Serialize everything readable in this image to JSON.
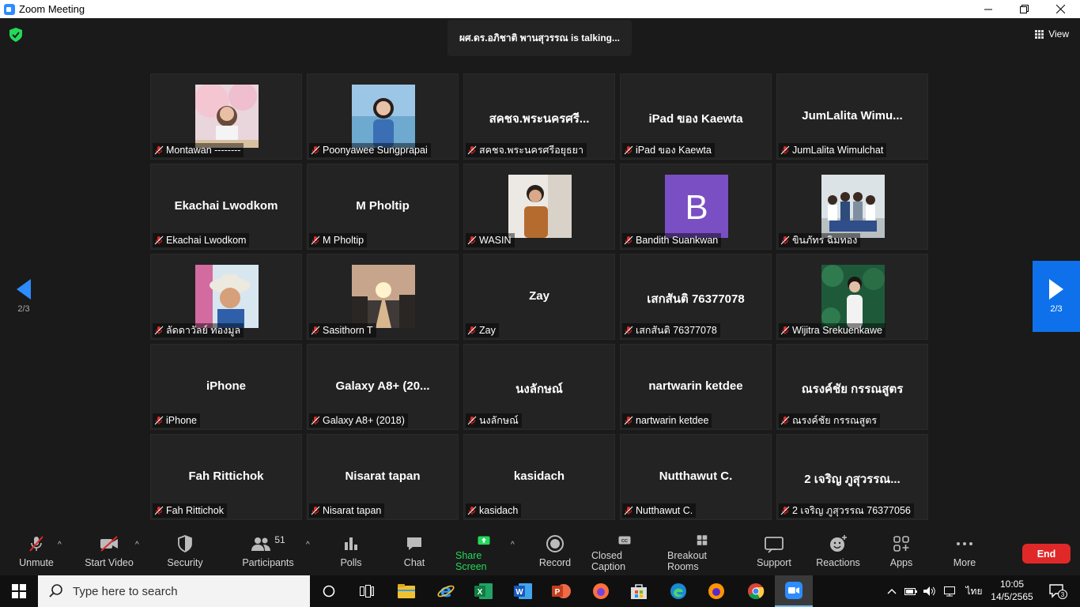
{
  "window": {
    "title": "Zoom Meeting"
  },
  "meeting": {
    "talking_text": "ผศ.ดร.อภิชาติ พานสุวรรณ  is  talking...",
    "view_label": "View",
    "page_indicator_left": "2/3",
    "page_indicator_right": "2/3"
  },
  "participants": [
    {
      "display": "",
      "label": "Montawan --------",
      "photo": "blossom"
    },
    {
      "display": "",
      "label": "Poonyawee Sungprapai",
      "photo": "beach"
    },
    {
      "display": "สคชจ.พระนครศรี...",
      "label": "สคชจ.พระนครศรีอยุธยา",
      "photo": ""
    },
    {
      "display": "iPad ของ Kaewta",
      "label": "iPad ของ Kaewta",
      "photo": ""
    },
    {
      "display": "JumLalita  Wimu...",
      "label": "JumLalita Wimulchat",
      "photo": ""
    },
    {
      "display": "Ekachai Lwodkom",
      "label": "Ekachai Lwodkom",
      "photo": ""
    },
    {
      "display": "M Pholtip",
      "label": "M Pholtip",
      "photo": ""
    },
    {
      "display": "",
      "label": "WASIN",
      "photo": "selfie"
    },
    {
      "display": "",
      "label": "Bandith Suankwan",
      "photo": "avatar-b",
      "avatar_letter": "B"
    },
    {
      "display": "",
      "label": "ขินภัทร ฉิมทอง",
      "photo": "group"
    },
    {
      "display": "",
      "label": "ลัดดาวัลย์ ทองมูล",
      "photo": "hat"
    },
    {
      "display": "",
      "label": "Sasithorn T",
      "photo": "sunset"
    },
    {
      "display": "Zay",
      "label": "Zay",
      "photo": ""
    },
    {
      "display": "เสกสันติ 76377078",
      "label": "เสกสันติ 76377078",
      "photo": ""
    },
    {
      "display": "",
      "label": "Wijitra Srekuenkawe",
      "photo": "leaves"
    },
    {
      "display": "iPhone",
      "label": "iPhone",
      "photo": ""
    },
    {
      "display": "Galaxy A8+ (20...",
      "label": "Galaxy A8+ (2018)",
      "photo": ""
    },
    {
      "display": "นงลักษณ์",
      "label": "นงลักษณ์",
      "photo": ""
    },
    {
      "display": "nartwarin ketdee",
      "label": "nartwarin ketdee",
      "photo": ""
    },
    {
      "display": "ณรงค์ชัย กรรณสูตร",
      "label": "ณรงค์ชัย กรรณสูตร",
      "photo": ""
    },
    {
      "display": "Fah Rittichok",
      "label": "Fah Rittichok",
      "photo": ""
    },
    {
      "display": "Nisarat tapan",
      "label": "Nisarat tapan",
      "photo": ""
    },
    {
      "display": "kasidach",
      "label": "kasidach",
      "photo": ""
    },
    {
      "display": "Nutthawut C.",
      "label": "Nutthawut C.",
      "photo": ""
    },
    {
      "display": "2 เจริญ ภูสุวรรณ...",
      "label": "2 เจริญ ภูสุวรรณ 76377056",
      "photo": ""
    }
  ],
  "toolbar": {
    "unmute": "Unmute",
    "start_video": "Start Video",
    "security": "Security",
    "participants": "Participants",
    "participants_count": "51",
    "polls": "Polls",
    "chat": "Chat",
    "share_screen": "Share Screen",
    "record": "Record",
    "closed_caption": "Closed Caption",
    "breakout_rooms": "Breakout Rooms",
    "support": "Support",
    "reactions": "Reactions",
    "apps": "Apps",
    "more": "More",
    "end": "End"
  },
  "taskbar": {
    "search_placeholder": "Type here to search",
    "language": "ไทย",
    "time": "10:05",
    "date": "14/5/2565",
    "notification_count": "3"
  },
  "colors": {
    "accent_blue": "#0e71eb",
    "share_green": "#23d959",
    "end_red": "#e02828",
    "mute_red": "#e02828"
  }
}
